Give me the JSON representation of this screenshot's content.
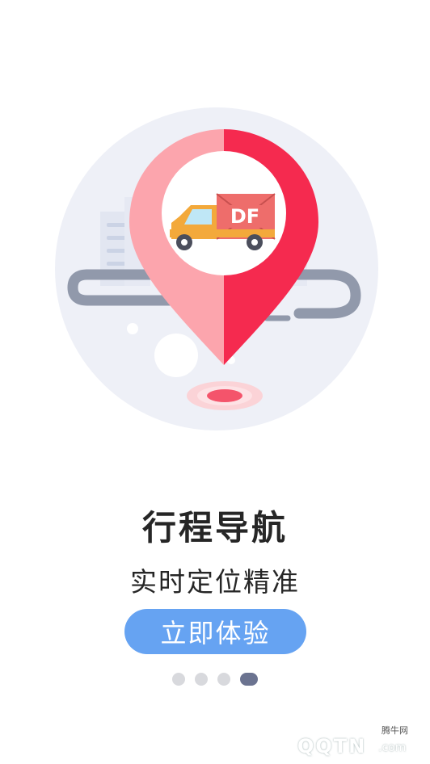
{
  "onboarding": {
    "title": "行程导航",
    "subtitle": "实时定位精准",
    "cta_label": "立即体验",
    "truck_badge": "DF",
    "page_index": 4,
    "page_count": 4
  },
  "watermark": {
    "site": "QQTN",
    "tld": ".com",
    "cn_name": "腾牛网"
  },
  "colors": {
    "background": "#ffffff",
    "circle_bg": "#eef0f7",
    "road": "#9199ab",
    "pin_left": "#fca5ad",
    "pin_right": "#f52a4f",
    "cta_bg": "#66a3f2",
    "dot_inactive": "#d8d9dd",
    "dot_active": "#6b7390",
    "text": "#262626"
  },
  "icons": {
    "pin": "location-pin-icon",
    "truck": "delivery-truck-icon"
  }
}
